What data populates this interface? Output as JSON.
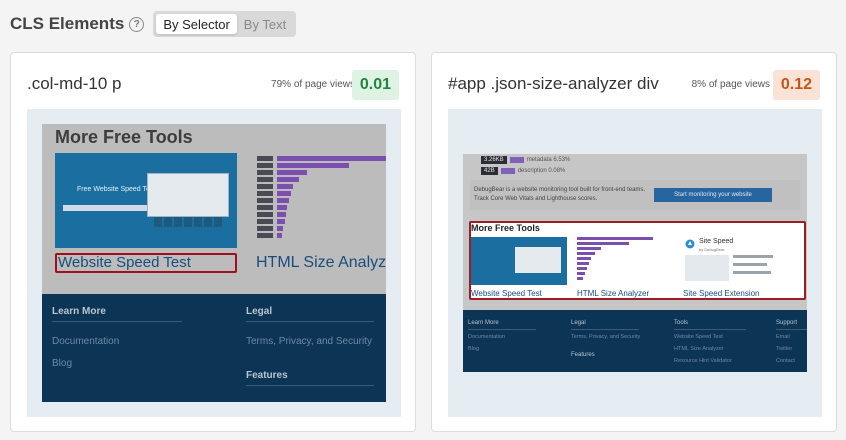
{
  "header": {
    "title": "CLS Elements",
    "help_icon": "?",
    "tabs": [
      {
        "label": "By Selector",
        "active": true
      },
      {
        "label": "By Text",
        "active": false
      }
    ]
  },
  "cards": [
    {
      "selector": ".col-md-10 p",
      "page_views": "79% of page views",
      "score": "0.01",
      "score_color": "#24843f",
      "screenshot": {
        "heading": "More Free Tools",
        "thumb_title": "Free Website Speed Test",
        "thumb_rows": [
          "6.4 KB",
          "3.9 KB",
          "1.8 KB",
          "1.0 KB",
          "0.9 KB",
          "0.8 KB",
          "0.8 KB",
          "0.6 KB",
          "0.5 KB",
          "0.4 KB",
          "0.3 KB",
          "0.2 KB"
        ],
        "link_highlighted": "Website Speed Test",
        "link_other": "HTML Size Analyzer",
        "footer": {
          "col1_heading": "Learn More",
          "col1_items": [
            "Documentation",
            "Blog"
          ],
          "col2_heading": "Legal",
          "col2_items": [
            "Terms, Privacy, and Security"
          ],
          "col3_heading": "Features"
        }
      }
    },
    {
      "selector": "#app .json-size-analyzer div",
      "page_views": "8% of page views",
      "score": "0.12",
      "score_color": "#c0591a",
      "screenshot": {
        "meta_rows": [
          {
            "size": "3.26KB",
            "label": "metadata 6.53%"
          },
          {
            "size": "42B",
            "label": "description 0.08%"
          }
        ],
        "info_text": "DebugBear is a website monitoring tool built for front-end teams. Track Core Web Vitals and Lighthouse scores.",
        "info_button": "Start monitoring your website",
        "heading": "More Free Tools",
        "thumb3_title": "Site Speed",
        "thumb3_sub": "by DebugBear",
        "links": [
          "Website Speed Test",
          "HTML Size Analyzer",
          "Site Speed Extension"
        ],
        "footer": {
          "col1_heading": "Learn More",
          "col1_items": [
            "Documentation",
            "Blog"
          ],
          "col2_heading": "Legal",
          "col2_items": [
            "Terms, Privacy, and Security"
          ],
          "col2b_heading": "Features",
          "col3_heading": "Tools",
          "col3_items": [
            "Website Speed Test",
            "HTML Size Analyzer",
            "Resource Hint Validator"
          ],
          "col4_heading": "Support",
          "col4_items": [
            "Email",
            "Twitter",
            "Contact"
          ]
        }
      }
    }
  ]
}
